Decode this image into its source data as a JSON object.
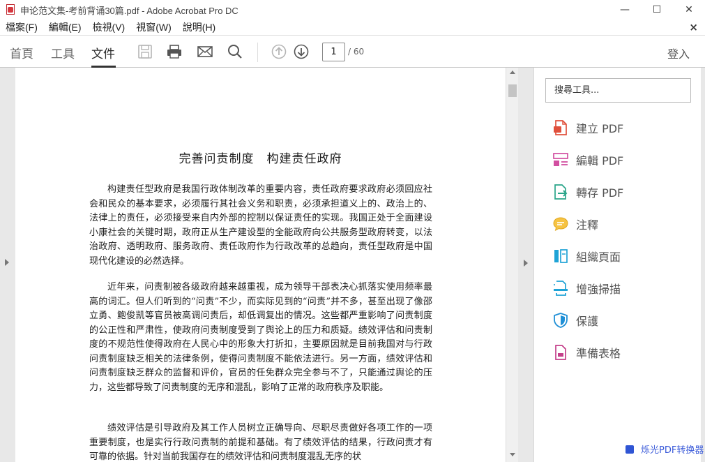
{
  "window": {
    "title": "申论范文集-考前背诵30篇.pdf - Adobe Acrobat Pro DC",
    "minimize": "—",
    "maximize": "☐",
    "close": "✕"
  },
  "menu": {
    "items": [
      "檔案(F)",
      "編輯(E)",
      "檢視(V)",
      "視窗(W)",
      "說明(H)"
    ],
    "close": "×"
  },
  "toolbar": {
    "tabs": [
      "首頁",
      "工具",
      "文件"
    ],
    "active_tab": "文件",
    "page_current": "1",
    "page_total": "/ 60",
    "login": "登入",
    "icons": [
      "save-icon",
      "print-icon",
      "email-icon",
      "search-icon",
      "page-up-icon",
      "page-down-icon"
    ]
  },
  "document": {
    "title": "完善问责制度　构建责任政府",
    "paragraphs": [
      "构建责任型政府是我国行政体制改革的重要内容，责任政府要求政府必须回应社会和民众的基本要求，必须履行其社会义务和职责，必须承担道义上的、政治上的、法律上的责任，必须接受来自内外部的控制以保证责任的实现。我国正处于全面建设小康社会的关键时期，政府正从生产建设型的全能政府向公共服务型政府转变，以法治政府、透明政府、服务政府、责任政府作为行政改革的总趋向，责任型政府是中国现代化建设的必然选择。",
      "近年来，问责制被各级政府越来越重视，成为领导干部表决心抓落实使用频率最高的词汇。但人们听到的“问责”不少，而实际见到的“问责”并不多，甚至出现了像邵立勇、鲍俊凯等官员被高调问责后，却低调复出的情况。这些都严重影响了问责制度的公正性和严肃性，使政府问责制度受到了舆论上的压力和质疑。绩效评估和问责制度的不规范性使得政府在人民心中的形象大打折扣，主要原因就是目前我国对与行政问责制度缺乏相关的法律条例，使得问责制度不能依法进行。另一方面，绩效评估和问责制度缺乏群众的监督和评价，官员的任免群众完全参与不了，只能通过舆论的压力，这些都导致了问责制度的无序和混乱，影响了正常的政府秩序及职能。",
      "绩效评估是引导政府及其工作人员树立正确导向、尽职尽责做好各项工作的一项重要制度，也是实行行政问责制的前提和基础。有了绩效评估的结果，行政问责才有可靠的依据。针对当前我国存在的绩效评估和问责制度混乱无序的状"
    ]
  },
  "right_pane": {
    "search_placeholder": "搜尋工具...",
    "tools": [
      {
        "label": "建立 PDF",
        "icon": "create-pdf-icon",
        "color": "#e0503c"
      },
      {
        "label": "編輯 PDF",
        "icon": "edit-pdf-icon",
        "color": "#d24fa1"
      },
      {
        "label": "轉存 PDF",
        "icon": "export-pdf-icon",
        "color": "#2aa58a"
      },
      {
        "label": "注釋",
        "icon": "comment-icon",
        "color": "#f0b429"
      },
      {
        "label": "組織頁面",
        "icon": "organize-pages-icon",
        "color": "#1fa3d6"
      },
      {
        "label": "增強掃描",
        "icon": "enhance-scan-icon",
        "color": "#1fa3d6"
      },
      {
        "label": "保護",
        "icon": "protect-icon",
        "color": "#1f8fd6"
      },
      {
        "label": "準備表格",
        "icon": "prepare-form-icon",
        "color": "#c43f8a"
      }
    ]
  },
  "watermark": "烁光PDF转换器"
}
